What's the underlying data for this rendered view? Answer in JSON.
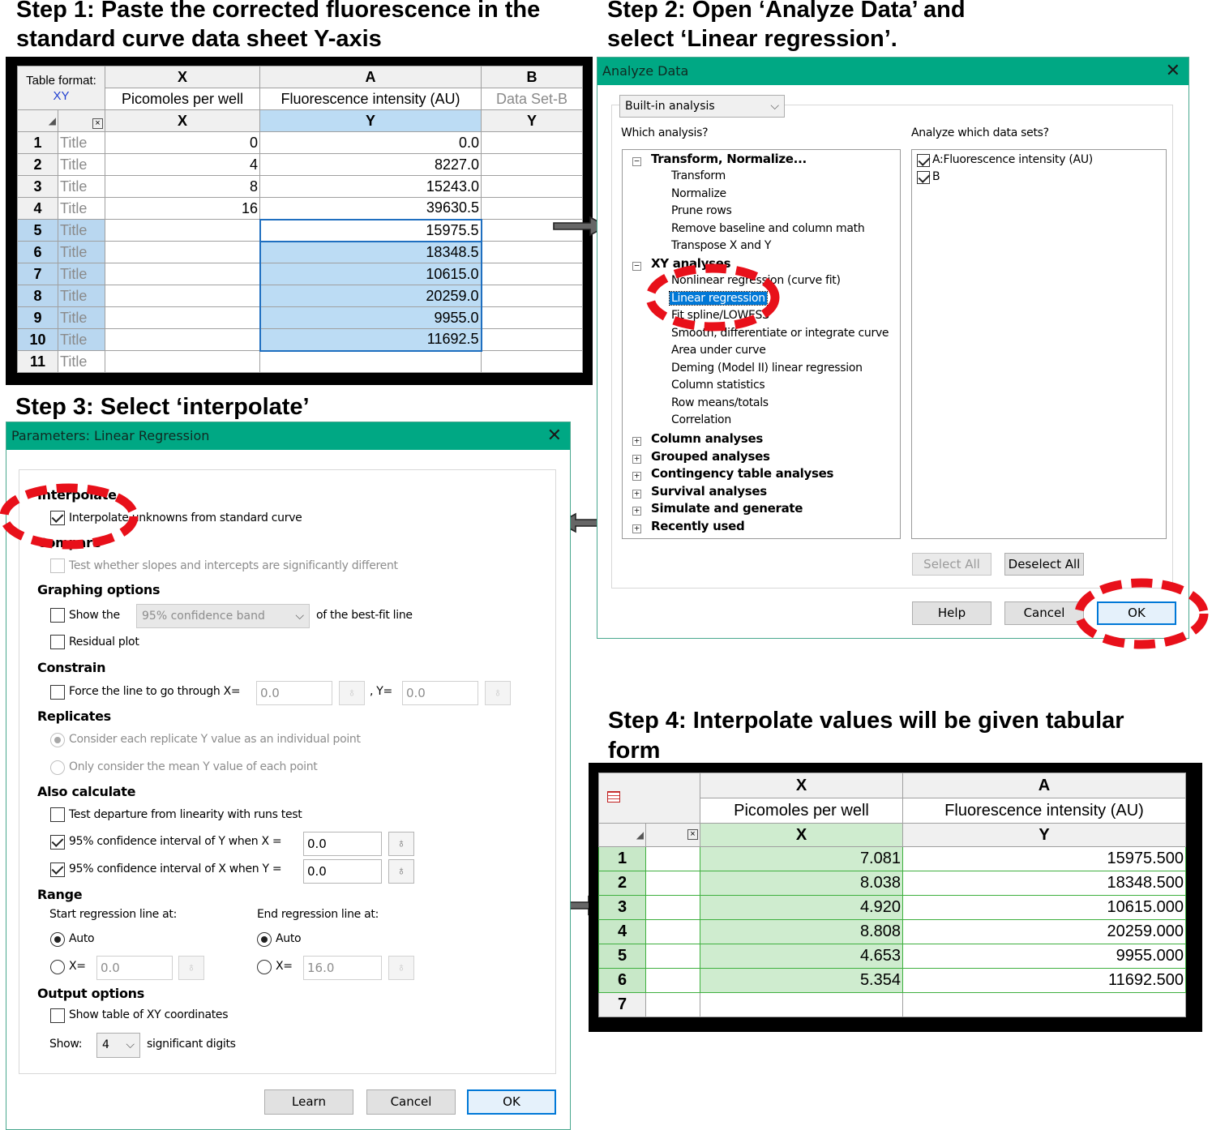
{
  "steps": {
    "step1": [
      "Step 1: Paste the corrected fluorescence in the",
      "standard curve data sheet Y-axis"
    ],
    "step2": [
      "Step 2: Open ‘Analyze Data’ and",
      "select ‘Linear regression’."
    ],
    "step3": "Step 3: Select ‘interpolate’",
    "step4": [
      "Step 4: Interpolate values will be given tabular",
      "form"
    ]
  },
  "sheet1": {
    "table_format_label": "Table format:",
    "table_format_value": "XY",
    "col_x_letter": "X",
    "col_a_letter": "A",
    "col_b_letter": "B",
    "col_x_title": "Picomoles per well",
    "col_a_title": "Fluorescence intensity (AU)",
    "col_b_title": "Data Set-B",
    "sub_x": "X",
    "sub_a": "Y",
    "sub_b": "Y",
    "corner_icon": "close-box-icon",
    "rows": [
      {
        "n": "1",
        "title": "Title",
        "x": "0",
        "y": "0.0"
      },
      {
        "n": "2",
        "title": "Title",
        "x": "4",
        "y": "8227.0"
      },
      {
        "n": "3",
        "title": "Title",
        "x": "8",
        "y": "15243.0"
      },
      {
        "n": "4",
        "title": "Title",
        "x": "16",
        "y": "39630.5"
      },
      {
        "n": "5",
        "title": "Title",
        "x": "",
        "y": "15975.5"
      },
      {
        "n": "6",
        "title": "Title",
        "x": "",
        "y": "18348.5"
      },
      {
        "n": "7",
        "title": "Title",
        "x": "",
        "y": "10615.0"
      },
      {
        "n": "8",
        "title": "Title",
        "x": "",
        "y": "20259.0"
      },
      {
        "n": "9",
        "title": "Title",
        "x": "",
        "y": "9955.0"
      },
      {
        "n": "10",
        "title": "Title",
        "x": "",
        "y": "11692.5"
      },
      {
        "n": "11",
        "title": "Title",
        "x": "",
        "y": ""
      }
    ]
  },
  "analyze": {
    "title": "Analyze Data",
    "combo": "Built-in analysis",
    "which_label": "Which analysis?",
    "datasets_label": "Analyze which data sets?",
    "tree": {
      "transform_group": "Transform, Normalize...",
      "transform_items": [
        "Transform",
        "Normalize",
        "Prune rows",
        "Remove baseline and column math",
        "Transpose X and Y"
      ],
      "xy_group": "XY analyses",
      "xy_items": [
        "Nonlinear regression (curve fit)",
        "Linear regression",
        "Fit spline/LOWESS",
        "Smooth, differentiate or integrate curve",
        "Area under curve",
        "Deming (Model II) linear regression",
        "Column statistics",
        "Row means/totals",
        "Correlation"
      ],
      "groups": [
        "Column analyses",
        "Grouped analyses",
        "Contingency table analyses",
        "Survival analyses",
        "Simulate and generate",
        "Recently used"
      ]
    },
    "datasets": [
      "A:Fluorescence intensity (AU)",
      "B"
    ],
    "select_all": "Select All",
    "deselect_all": "Deselect All",
    "help": "Help",
    "cancel": "Cancel",
    "ok": "OK"
  },
  "params": {
    "title": "Parameters: Linear Regression",
    "interpolate_head": "Interpolate",
    "interpolate_cb": "Interpolate unknowns from standard curve",
    "compare_head": "Compare",
    "compare_cb": "Test whether slopes and intercepts are significantly different",
    "graphing_head": "Graphing options",
    "show_the": "Show the",
    "band_combo": "95% confidence band",
    "band_tail": "of the best-fit line",
    "residual": "Residual plot",
    "constrain_head": "Constrain",
    "force_line": "Force the line to go through X=",
    "force_x": "0.0",
    "force_y_label": ", Y=",
    "force_y": "0.0",
    "replicates_head": "Replicates",
    "rep_each": "Consider each replicate Y value as an individual point",
    "rep_mean": "Only consider the mean Y value of each point",
    "also_head": "Also calculate",
    "runs_test": "Test departure from linearity with runs test",
    "ci_y": "95% confidence interval of Y when X =",
    "ci_y_val": "0.0",
    "ci_x": "95% confidence interval of X when Y =",
    "ci_x_val": "0.0",
    "range_head": "Range",
    "start_label": "Start regression line at:",
    "end_label": "End regression line at:",
    "auto": "Auto",
    "xeq": "X=",
    "start_x": "0.0",
    "end_x": "16.0",
    "output_head": "Output options",
    "show_table": "Show table of XY coordinates",
    "show_label": "Show:",
    "digits": "4",
    "digits_tail": "significant digits",
    "learn": "Learn",
    "cancel": "Cancel",
    "ok": "OK"
  },
  "sheet2": {
    "col_x_letter": "X",
    "col_a_letter": "A",
    "col_x_title": "Picomoles per well",
    "col_a_title": "Fluorescence intensity (AU)",
    "sub_x": "X",
    "sub_a": "Y",
    "table_icon": "table-icon",
    "rows": [
      {
        "n": "1",
        "x": "7.081",
        "y": "15975.500"
      },
      {
        "n": "2",
        "x": "8.038",
        "y": "18348.500"
      },
      {
        "n": "3",
        "x": "4.920",
        "y": "10615.000"
      },
      {
        "n": "4",
        "x": "8.808",
        "y": "20259.000"
      },
      {
        "n": "5",
        "x": "4.653",
        "y": "9955.000"
      },
      {
        "n": "6",
        "x": "5.354",
        "y": "11692.500"
      },
      {
        "n": "7",
        "x": "",
        "y": ""
      }
    ]
  },
  "colors": {
    "dialog_title_bar": "#00a884",
    "highlight_circle": "#e8101a",
    "selection_blue": "#bcdcf4",
    "selection_green": "#cfeccf",
    "tree_selected": "#0078d7"
  }
}
